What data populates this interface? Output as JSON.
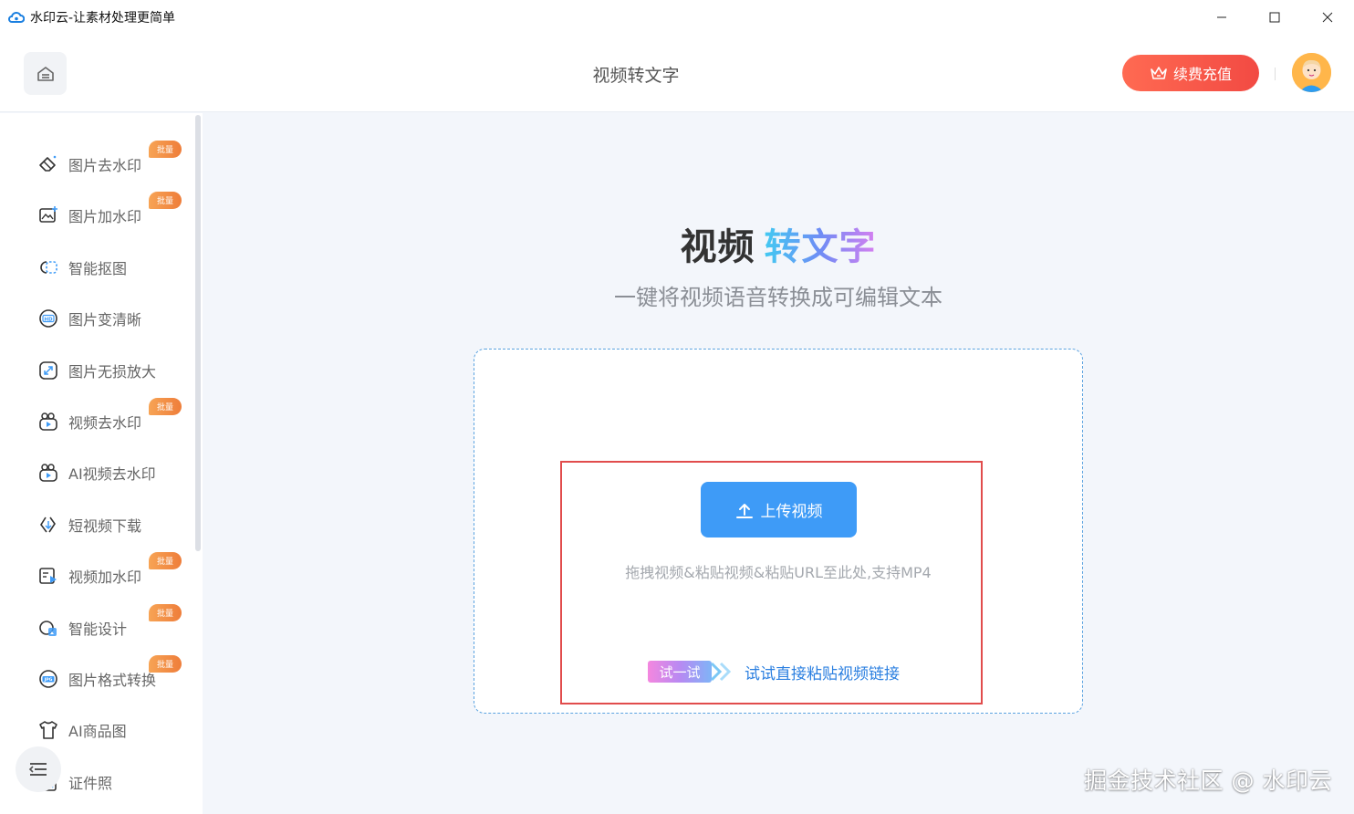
{
  "window": {
    "title": "水印云-让素材处理更简单"
  },
  "header": {
    "page_title": "视频转文字",
    "recharge_label": "续费充值",
    "home_icon": "home-icon",
    "avatar_icon": "avatar"
  },
  "sidebar": {
    "items": [
      {
        "label": "图片去水印",
        "icon": "eraser-icon",
        "badge": "批量"
      },
      {
        "label": "图片加水印",
        "icon": "image-add-icon",
        "badge": "批量"
      },
      {
        "label": "智能抠图",
        "icon": "cutout-icon",
        "badge": ""
      },
      {
        "label": "图片变清晰",
        "icon": "hd-icon",
        "badge": ""
      },
      {
        "label": "图片无损放大",
        "icon": "enlarge-icon",
        "badge": ""
      },
      {
        "label": "视频去水印",
        "icon": "video-eraser-icon",
        "badge": "批量"
      },
      {
        "label": "AI视频去水印",
        "icon": "ai-video-eraser-icon",
        "badge": ""
      },
      {
        "label": "短视频下载",
        "icon": "download-link-icon",
        "badge": ""
      },
      {
        "label": "视频加水印",
        "icon": "video-add-icon",
        "badge": "批量"
      },
      {
        "label": "智能设计",
        "icon": "design-icon",
        "badge": "批量"
      },
      {
        "label": "图片格式转换",
        "icon": "jpg-convert-icon",
        "badge": "批量"
      },
      {
        "label": "AI商品图",
        "icon": "shirt-icon",
        "badge": ""
      },
      {
        "label": "证件照",
        "icon": "id-photo-icon",
        "badge": ""
      }
    ],
    "menu_icon": "menu-collapse-icon"
  },
  "main": {
    "hero_title_part1": "视频",
    "hero_title_part2": "转文字",
    "hero_subtitle": "一键将视频语音转换成可编辑文本",
    "upload_label": "上传视频",
    "hint": "拖拽视频&粘贴视频&粘贴URL至此处,支持MP4",
    "try_tag": "试一试",
    "try_link": "试试直接粘贴视频链接"
  },
  "watermark": "掘金技术社区 @ 水印云",
  "colors": {
    "accent_blue": "#3e9bf7",
    "recharge_red": "#f24a43",
    "badge_orange": "#ee7d3a",
    "highlight_red": "#e14c4c"
  }
}
